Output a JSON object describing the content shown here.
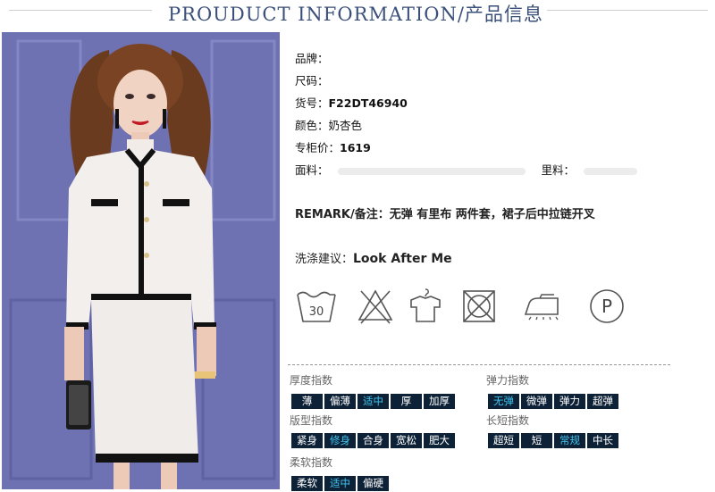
{
  "header": {
    "title": "PROUDUCT INFORMATION/产品信息"
  },
  "info": {
    "brand_label": "品牌：",
    "size_label": "尺码：",
    "sku_label": "货号：",
    "sku_value": "F22DT46940",
    "color_label": "颜色：",
    "color_value": "奶杏色",
    "price_label": "专柜价：",
    "price_value": "1619",
    "fabric_label": "面料：",
    "lining_label": "里料："
  },
  "remark": {
    "label": "REMARK/备注：",
    "value": "无弹 有里布 两件套，裙子后中拉链开叉"
  },
  "wash": {
    "label": "洗涤建议：",
    "value": "Look After Me"
  },
  "care_icons": [
    {
      "name": "wash-30-icon",
      "text": "30"
    },
    {
      "name": "no-bleach-icon"
    },
    {
      "name": "hang-dry-icon"
    },
    {
      "name": "no-tumble-dry-icon"
    },
    {
      "name": "low-iron-icon"
    },
    {
      "name": "dry-clean-p-icon",
      "text": "P"
    }
  ],
  "attributes": {
    "thickness": {
      "title": "厚度指数",
      "options": [
        "薄",
        "偏薄",
        "适中",
        "厚",
        "加厚"
      ],
      "selected": "适中"
    },
    "elasticity": {
      "title": "弹力指数",
      "options": [
        "无弹",
        "微弹",
        "弹力",
        "超弹"
      ],
      "selected": "无弹"
    },
    "fit": {
      "title": "版型指数",
      "options": [
        "紧身",
        "修身",
        "合身",
        "宽松",
        "肥大"
      ],
      "selected": "修身"
    },
    "length": {
      "title": "长短指数",
      "options": [
        "超短",
        "短",
        "常规",
        "中长"
      ],
      "selected": "常规"
    },
    "softness": {
      "title": "柔软指数",
      "options": [
        "柔软",
        "适中",
        "偏硬"
      ],
      "selected": "适中"
    }
  },
  "colors": {
    "title": "#3a4f7a",
    "tag_bg": "#0e2237",
    "tag_selected_text": "#3ec4ee"
  }
}
